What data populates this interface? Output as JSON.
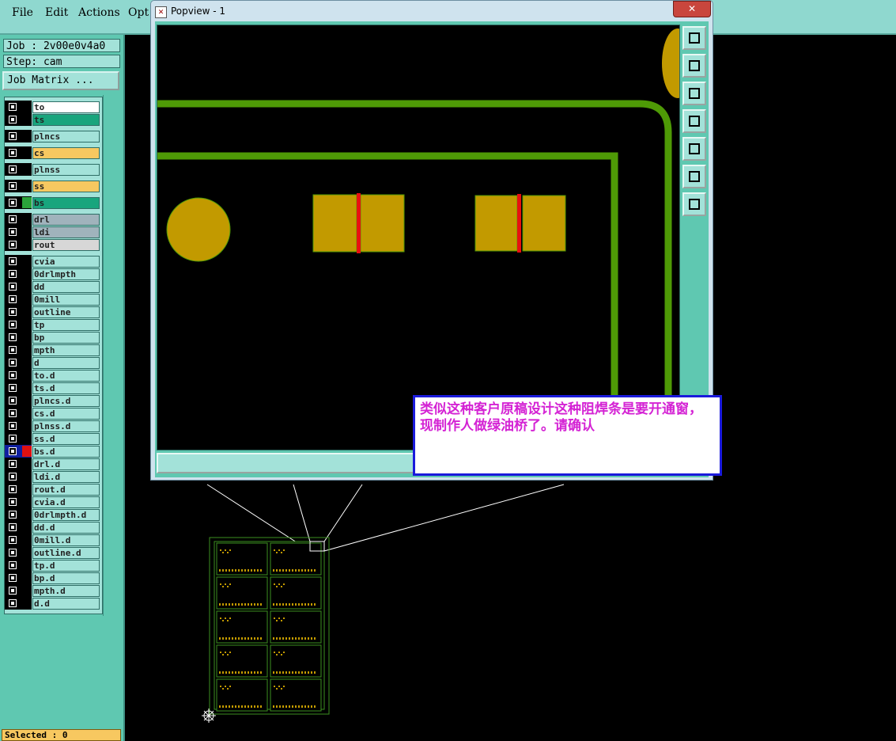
{
  "menubar": {
    "items": [
      {
        "label": "File"
      },
      {
        "label": "Edit"
      },
      {
        "label": "Actions"
      },
      {
        "label": "Opt"
      }
    ]
  },
  "job": {
    "job_label": "Job : 2v00e0v4a0",
    "step_label": "Step: cam",
    "matrix_button": "Job Matrix ..."
  },
  "layers": [
    {
      "name": "to",
      "bg": "#ffffff"
    },
    {
      "name": "ts",
      "bg": "#18a57d"
    },
    {
      "name": "plncs",
      "bg": "#a3e2d9"
    },
    {
      "name": "cs",
      "bg": "#f7c860"
    },
    {
      "name": "plnss",
      "bg": "#a3e2d9"
    },
    {
      "name": "ss",
      "bg": "#f7c860"
    },
    {
      "name": "bs",
      "bg": "#18a57d",
      "color": "#2aa33a"
    },
    {
      "name": "drl",
      "bg": "#a0b3bc"
    },
    {
      "name": "ldi",
      "bg": "#a0b3bc"
    },
    {
      "name": "rout",
      "bg": "#d7d7d7"
    },
    {
      "name": "cvia",
      "bg": "#a3e2d9"
    },
    {
      "name": "0drlmpth",
      "bg": "#a3e2d9"
    },
    {
      "name": "dd",
      "bg": "#a3e2d9"
    },
    {
      "name": "0mill",
      "bg": "#a3e2d9"
    },
    {
      "name": "outline",
      "bg": "#a3e2d9"
    },
    {
      "name": "tp",
      "bg": "#a3e2d9"
    },
    {
      "name": "bp",
      "bg": "#a3e2d9"
    },
    {
      "name": "mpth",
      "bg": "#a3e2d9"
    },
    {
      "name": "d",
      "bg": "#a3e2d9"
    },
    {
      "name": "to.d",
      "bg": "#a3e2d9"
    },
    {
      "name": "ts.d",
      "bg": "#a3e2d9"
    },
    {
      "name": "plncs.d",
      "bg": "#a3e2d9"
    },
    {
      "name": "cs.d",
      "bg": "#a3e2d9"
    },
    {
      "name": "plnss.d",
      "bg": "#a3e2d9"
    },
    {
      "name": "ss.d",
      "bg": "#a3e2d9"
    },
    {
      "name": "bs.d",
      "bg": "#a3e2d9",
      "color": "#e01010",
      "active": true
    },
    {
      "name": "drl.d",
      "bg": "#a3e2d9"
    },
    {
      "name": "ldi.d",
      "bg": "#a3e2d9"
    },
    {
      "name": "rout.d",
      "bg": "#a3e2d9"
    },
    {
      "name": "cvia.d",
      "bg": "#a3e2d9"
    },
    {
      "name": "0drlmpth.d",
      "bg": "#a3e2d9"
    },
    {
      "name": "dd.d",
      "bg": "#a3e2d9"
    },
    {
      "name": "0mill.d",
      "bg": "#a3e2d9"
    },
    {
      "name": "outline.d",
      "bg": "#a3e2d9"
    },
    {
      "name": "tp.d",
      "bg": "#a3e2d9"
    },
    {
      "name": "bp.d",
      "bg": "#a3e2d9"
    },
    {
      "name": "mpth.d",
      "bg": "#a3e2d9"
    },
    {
      "name": "d.d",
      "bg": "#a3e2d9"
    }
  ],
  "status": {
    "selected": "Selected : 0"
  },
  "popview": {
    "title": "Popview - 1",
    "close_glyph": "✕",
    "toolbar_icons": [
      "zoom-fit-icon",
      "pan-up-icon",
      "pan-down-icon",
      "pan-left-icon",
      "pan-right-icon",
      "zoom-in-icon",
      "zoom-out-icon"
    ]
  },
  "annotation": {
    "text": "类似这种客户原稿设计这种阻焊条是要开通窗，现制作人做绿油桥了。请确认"
  },
  "colors": {
    "trace": "#4e9a06",
    "pad": "#c29a00",
    "mask_bar": "#e81010"
  }
}
